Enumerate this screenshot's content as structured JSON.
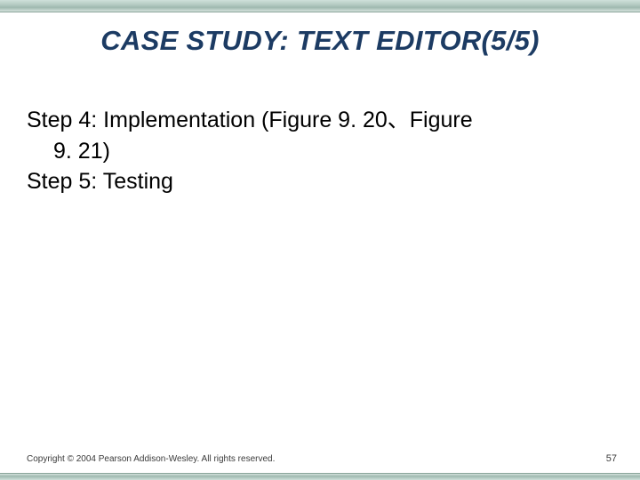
{
  "title": "CASE STUDY: TEXT EDITOR(5/5)",
  "step4_line1": "Step 4: Implementation (Figure 9. 20、Figure",
  "step4_line2": "9. 21)",
  "step5": "Step 5: Testing",
  "copyright": "Copyright © 2004 Pearson Addison-Wesley. All rights reserved.",
  "page_number": "57"
}
